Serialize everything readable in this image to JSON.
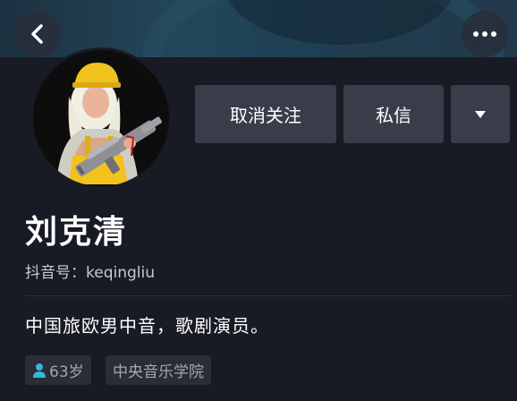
{
  "profile": {
    "name": "刘克清",
    "douyin_id_label": "抖音号：",
    "douyin_id": "keqingliu",
    "bio": "中国旅欧男中音，歌剧演员。"
  },
  "actions": {
    "unfollow_label": "取消关注",
    "message_label": "私信"
  },
  "tags": {
    "age": "63岁",
    "school": "中央音乐学院"
  },
  "icons": {
    "back": "chevron-left-icon",
    "more": "more-dots-icon",
    "dropdown": "caret-down-icon",
    "age": "person-icon"
  },
  "colors": {
    "background": "#181a24",
    "button": "#3a3c4a",
    "tag_bg": "#2a2c38",
    "age_icon": "#35b8d6"
  }
}
